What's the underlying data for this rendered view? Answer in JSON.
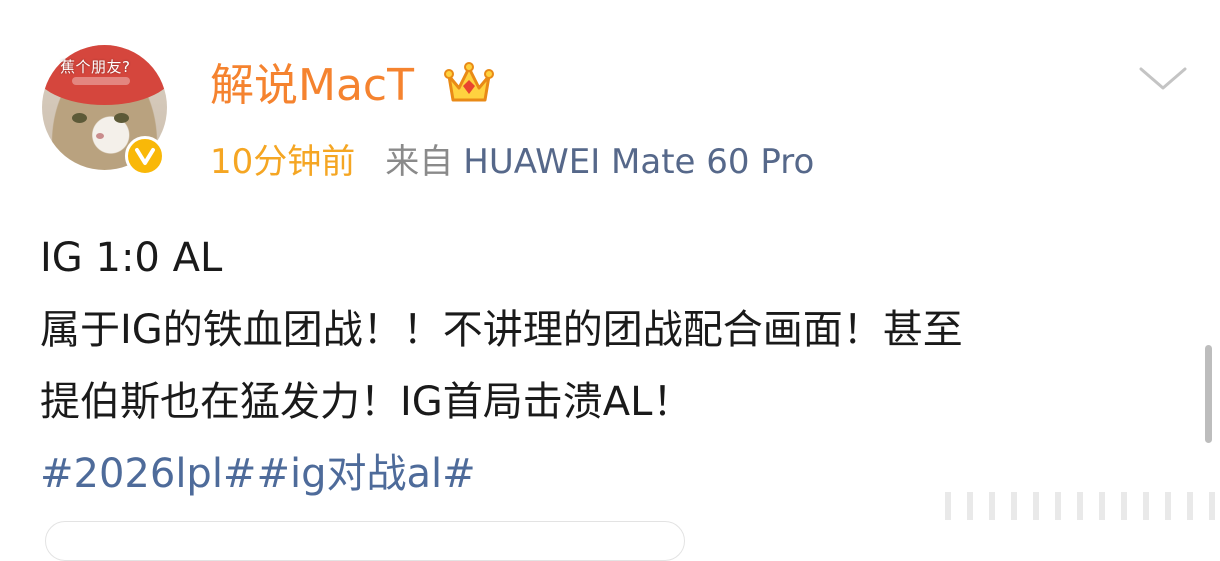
{
  "post": {
    "avatar_caption": "蕉个朋友?",
    "username": "解说MacT",
    "time": "10分钟前",
    "source_prefix": "来自",
    "device": "HUAWEI Mate 60 Pro",
    "content_lines": [
      "IG 1:0 AL",
      "属于IG的铁血团战！！不讲理的团战配合画面！甚至",
      "提伯斯也在猛发力！IG首局击溃AL！"
    ],
    "hashtags": "#2026lpl##ig对战al#"
  },
  "icons": {
    "verified": "verified-v-badge-icon",
    "crown": "crown-vip-icon",
    "menu": "chevron-down-icon"
  },
  "colors": {
    "username": "#f5832f",
    "time": "#f5a623",
    "source": "#8a8a8a",
    "device": "#56688a",
    "hashtag": "#4e6b9a",
    "text": "#1a1a1a",
    "verified_badge": "#f9b808"
  }
}
